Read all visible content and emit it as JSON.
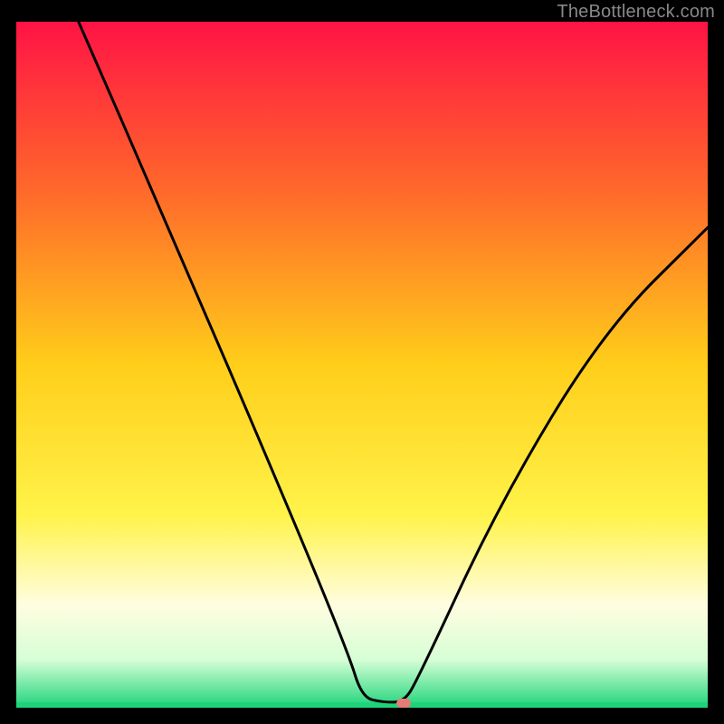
{
  "attribution": "TheBottleneck.com",
  "chart_data": {
    "type": "line",
    "title": "",
    "xlabel": "",
    "ylabel": "",
    "xlim": [
      0,
      100
    ],
    "ylim": [
      0,
      100
    ],
    "gradient_stops": [
      {
        "offset": 0,
        "color": "#ff1345"
      },
      {
        "offset": 25,
        "color": "#ff6a2a"
      },
      {
        "offset": 50,
        "color": "#ffce1a"
      },
      {
        "offset": 72,
        "color": "#fff34a"
      },
      {
        "offset": 85,
        "color": "#fffde0"
      },
      {
        "offset": 93,
        "color": "#d6ffd6"
      },
      {
        "offset": 100,
        "color": "#1dd47a"
      }
    ],
    "series": [
      {
        "name": "bottleneck-curve",
        "points": [
          {
            "x": 9,
            "y": 100
          },
          {
            "x": 22,
            "y": 70
          },
          {
            "x": 39,
            "y": 30
          },
          {
            "x": 48,
            "y": 8
          },
          {
            "x": 50,
            "y": 1.5
          },
          {
            "x": 53,
            "y": 0.8
          },
          {
            "x": 56,
            "y": 0.8
          },
          {
            "x": 58,
            "y": 4
          },
          {
            "x": 70,
            "y": 30
          },
          {
            "x": 85,
            "y": 55
          },
          {
            "x": 100,
            "y": 70
          }
        ]
      }
    ],
    "marker": {
      "x": 56,
      "y": 0.6
    },
    "green_baseline": {
      "y": 0,
      "height_pct": 0.8
    }
  }
}
